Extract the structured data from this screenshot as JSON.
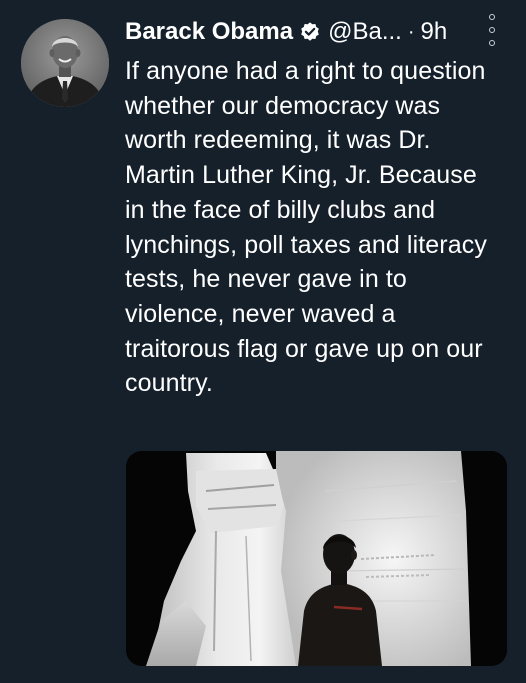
{
  "tweet": {
    "author": {
      "display_name": "Barack Obama",
      "handle": "@Ba...",
      "verified_icon": "verified-badge-icon",
      "avatar_icon": "avatar-portrait"
    },
    "separator": "·",
    "timestamp": "9h",
    "more_icon": "more-options-icon",
    "text": "If anyone had a right to question whether our democracy was worth redeeming, it was Dr. Martin Luther King, Jr. Because in the face of billy clubs and lynchings, poll taxes and literacy tests, he never gave in to violence, never waved a traitorous flag or gave up on our country.",
    "media": {
      "type": "photo",
      "icon": "photo-mlk-memorial-image"
    }
  },
  "colors": {
    "background": "#15202b",
    "text": "#ffffff",
    "verified_badge": "#ffffff"
  }
}
